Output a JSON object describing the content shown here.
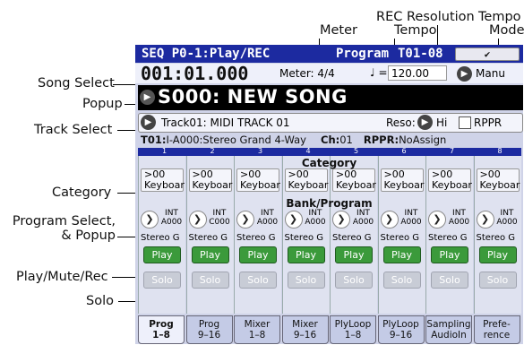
{
  "callouts": {
    "rec_resolution": "REC Resolution",
    "tempo_mode_1": "Tempo",
    "tempo_mode_2": "Mode",
    "meter": "Meter",
    "tempo": "Tempo",
    "song_select": "Song Select",
    "popup": "Popup",
    "track_select": "Track Select",
    "category": "Category",
    "program_select_1": "Program Select,",
    "program_select_2": "& Popup",
    "play_mute_rec": "Play/Mute/Rec",
    "solo": "Solo"
  },
  "header": {
    "mode": "SEQ P0-1:Play/REC",
    "program_label": "Program",
    "program_value": "T01-08",
    "checkbox": "✔"
  },
  "transport": {
    "position": "001:01.000",
    "meter_label": "Meter:",
    "meter_value": "4/4",
    "tempo_symbol": "♩ =",
    "tempo_value": "120.00",
    "tempo_mode": "Manu"
  },
  "song": {
    "name": "S000: NEW SONG"
  },
  "track": {
    "name": "Track01: MIDI TRACK 01",
    "reso_label": "Reso:",
    "reso_value": "Hi",
    "rppr_label": "RPPR"
  },
  "info": {
    "track": "T01:",
    "program": "I-A000:Stereo Grand 4-Way",
    "ch_label": "Ch:",
    "ch_value": "01",
    "rppr_label": "RPPR:",
    "rppr_value": "NoAssign"
  },
  "sections": {
    "category": "Category",
    "bank": "Bank/Program"
  },
  "tracks": [
    {
      "num": "1",
      "cat1": ">00",
      "cat2": "Keyboar",
      "bank1": "INT",
      "bank2": "A000",
      "prog": "Stereo G",
      "play": "Play",
      "solo": "Solo"
    },
    {
      "num": "2",
      "cat1": ">00",
      "cat2": "Keyboar",
      "bank1": "INT",
      "bank2": "C000",
      "prog": "Stereo G",
      "play": "Play",
      "solo": "Solo"
    },
    {
      "num": "3",
      "cat1": ">00",
      "cat2": "Keyboar",
      "bank1": "INT",
      "bank2": "A000",
      "prog": "Stereo G",
      "play": "Play",
      "solo": "Solo"
    },
    {
      "num": "4",
      "cat1": ">00",
      "cat2": "Keyboar",
      "bank1": "INT",
      "bank2": "A000",
      "prog": "Stereo G",
      "play": "Play",
      "solo": "Solo"
    },
    {
      "num": "5",
      "cat1": ">00",
      "cat2": "Keyboar",
      "bank1": "INT",
      "bank2": "A000",
      "prog": "Stereo G",
      "play": "Play",
      "solo": "Solo"
    },
    {
      "num": "6",
      "cat1": ">00",
      "cat2": "Keyboar",
      "bank1": "INT",
      "bank2": "A000",
      "prog": "Stereo G",
      "play": "Play",
      "solo": "Solo"
    },
    {
      "num": "7",
      "cat1": ">00",
      "cat2": "Keyboar",
      "bank1": "INT",
      "bank2": "A000",
      "prog": "Stereo G",
      "play": "Play",
      "solo": "Solo"
    },
    {
      "num": "8",
      "cat1": ">00",
      "cat2": "Keyboar",
      "bank1": "INT",
      "bank2": "A000",
      "prog": "Stereo G",
      "play": "Play",
      "solo": "Solo"
    }
  ],
  "tabs": [
    {
      "l1": "Prog",
      "l2": "1–8"
    },
    {
      "l1": "Prog",
      "l2": "9–16"
    },
    {
      "l1": "Mixer",
      "l2": "1–8"
    },
    {
      "l1": "Mixer",
      "l2": "9–16"
    },
    {
      "l1": "PlyLoop",
      "l2": "1–8"
    },
    {
      "l1": "PlyLoop",
      "l2": "9–16"
    },
    {
      "l1": "Sampling",
      "l2": "AudioIn"
    },
    {
      "l1": "Prefe-",
      "l2": "rence"
    }
  ],
  "colors": {
    "title_bar": "#1c2aa0",
    "play_green": "#3b9a3b",
    "screen_bg": "#cfd3e8"
  }
}
